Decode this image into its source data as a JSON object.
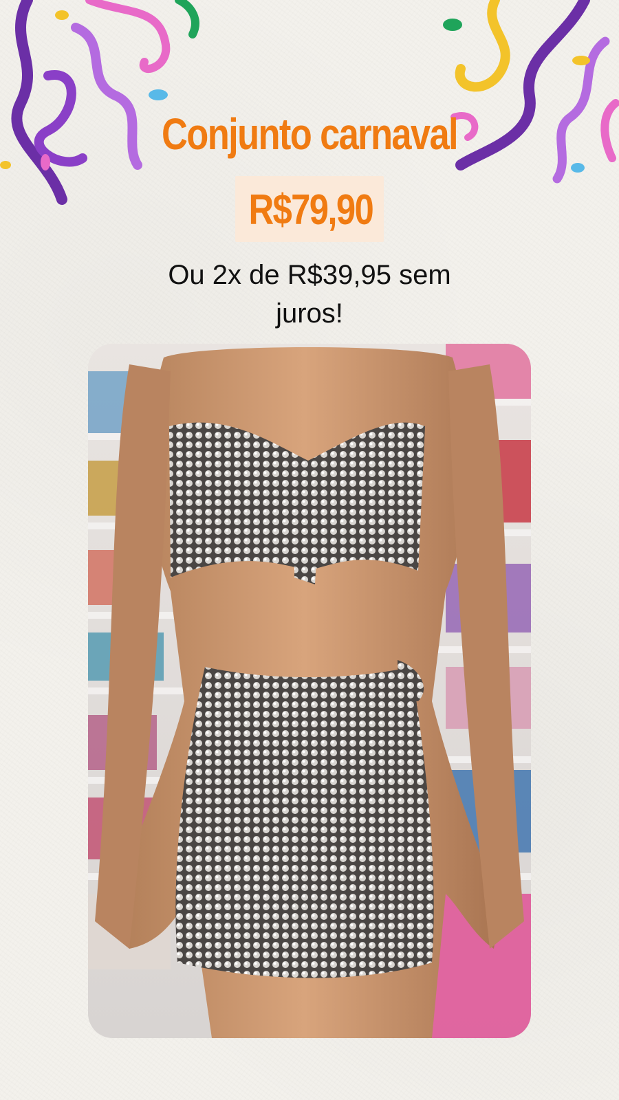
{
  "product": {
    "title": "Conjunto carnaval",
    "price": "R$79,90",
    "installments": "Ou 2x de R$39,95 sem juros!"
  },
  "colors": {
    "accent": "#f07b12",
    "price_background": "#fbe9d9",
    "background": "#f3f1ec",
    "confetti_purple": "#6b2fa6",
    "confetti_pink": "#e86ac8",
    "confetti_yellow": "#f3c32a",
    "confetti_green": "#1fa45a",
    "confetti_blue": "#58b9e8"
  },
  "images": {
    "confetti_left": "confetti-streamers-icon",
    "confetti_right": "confetti-streamers-icon",
    "product_photo": "sequin-top-and-skirt-on-mannequin"
  }
}
